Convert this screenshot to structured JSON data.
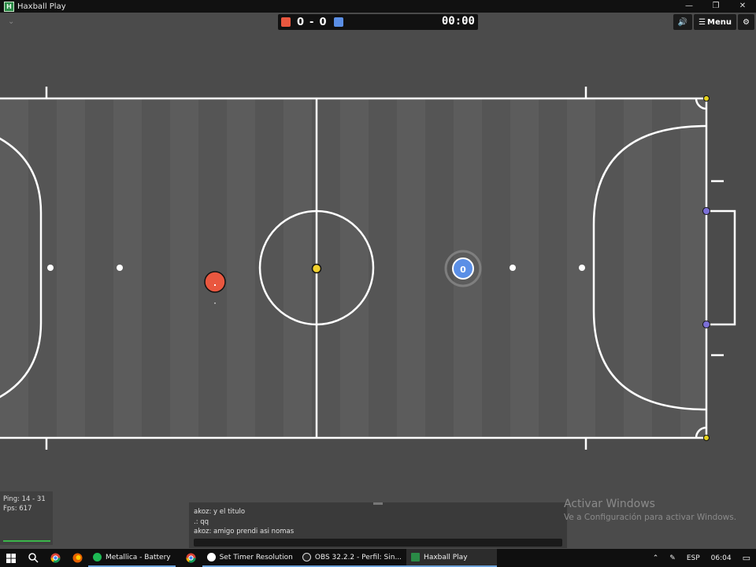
{
  "window": {
    "title": "Haxball Play",
    "app_icon": "H"
  },
  "window_controls": {
    "minimize": "—",
    "maximize": "❐",
    "close": "✕"
  },
  "scoreboard": {
    "red_score": "0",
    "separator": "-",
    "blue_score": "0",
    "time": "00:00",
    "red_color": "#e9573f",
    "blue_color": "#5b8fe6"
  },
  "top_buttons": {
    "menu_label": "Menu",
    "sound_icon": "🔊",
    "settings_icon": "⚙",
    "menu_icon": "☰"
  },
  "players": [
    {
      "team": "red",
      "avatar": ".",
      "color": "#e9573f"
    },
    {
      "team": "blue",
      "avatar": "0",
      "color": "#5b8fe6"
    }
  ],
  "ball": {
    "color": "#f2d12c"
  },
  "stats": {
    "ping": "Ping: 14 - 31",
    "fps": "Fps: 617"
  },
  "chat": {
    "messages": [
      "akoz: y el titulo",
      ".: qq",
      "akoz: amigo prendi asi nomas"
    ],
    "input_value": ""
  },
  "watermark": {
    "title": "Activar Windows",
    "subtitle": "Ve a Configuración para activar Windows."
  },
  "taskbar": {
    "items": [
      "Metallica - Battery",
      "Set Timer Resolution",
      "OBS 32.2.2 - Perfil: Sin...",
      "Haxball Play"
    ],
    "language": "ESP",
    "clock": "06:04"
  },
  "colors": {
    "field_lines": "#ffffff",
    "field_bg": "#5b5b5b",
    "goalpost": "#7b6fd6",
    "corner_post": "#e4d11e"
  }
}
